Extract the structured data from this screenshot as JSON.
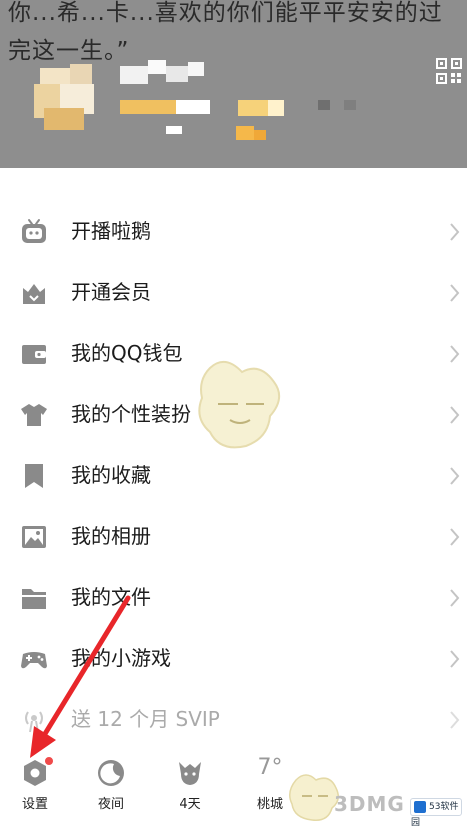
{
  "header": {
    "signature": "你...希...卡...喜欢的你们能平平安安的过完这一生。”",
    "qr_icon": "qr-code-icon"
  },
  "menu": {
    "items": [
      {
        "label": "开播啦鹅",
        "icon": "tv-icon"
      },
      {
        "label": "开通会员",
        "icon": "crown-bag-icon"
      },
      {
        "label": "我的QQ钱包",
        "icon": "wallet-icon"
      },
      {
        "label": "我的个性装扮",
        "icon": "shirt-icon"
      },
      {
        "label": "我的收藏",
        "icon": "bookmark-icon"
      },
      {
        "label": "我的相册",
        "icon": "photo-icon"
      },
      {
        "label": "我的文件",
        "icon": "folder-icon"
      },
      {
        "label": "我的小游戏",
        "icon": "gamepad-icon"
      },
      {
        "label": "送 12 个月 SVIP",
        "icon": "broadcast-icon"
      }
    ]
  },
  "toolbar": {
    "items": [
      {
        "label": "设置",
        "icon": "settings-icon"
      },
      {
        "label": "夜间",
        "icon": "moon-icon"
      },
      {
        "label": "4天",
        "icon": "pet-icon"
      },
      {
        "label": "桃城",
        "icon": "weather-icon",
        "temp": "7°"
      }
    ]
  },
  "colors": {
    "header_bg": "#8e8e8e",
    "accent_red": "#e8262a",
    "icon_gray": "#8a8a8a"
  },
  "watermark": {
    "site": "3DMG",
    "site2": "53软件园"
  }
}
